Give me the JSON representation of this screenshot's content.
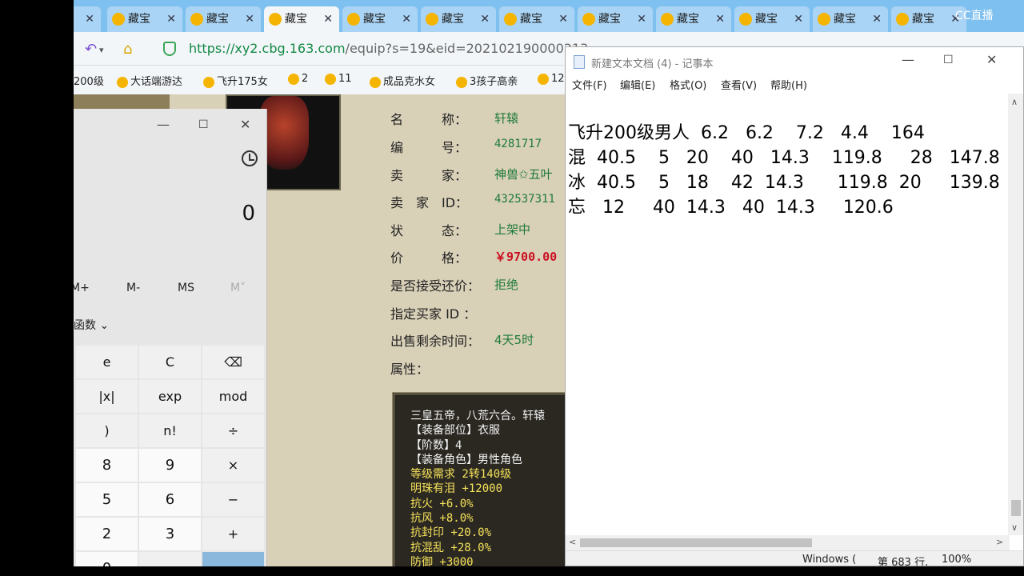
{
  "browser": {
    "tabs": [
      {
        "label": "",
        "active": false
      },
      {
        "label": "藏宝",
        "active": false
      },
      {
        "label": "藏宝",
        "active": false
      },
      {
        "label": "藏宝",
        "active": true
      },
      {
        "label": "藏宝",
        "active": false
      },
      {
        "label": "藏宝",
        "active": false
      },
      {
        "label": "藏宝",
        "active": false
      },
      {
        "label": "藏宝",
        "active": false
      },
      {
        "label": "藏宝",
        "active": false
      },
      {
        "label": "藏宝",
        "active": false
      },
      {
        "label": "藏宝",
        "active": false
      },
      {
        "label": "藏宝",
        "active": false
      }
    ],
    "url_main": "https://xy2.cbg.163.com",
    "url_rest": "/equip?s=19&eid=202102190000213",
    "bookmarks": [
      "200级",
      "大话端游达",
      "飞升175女",
      "2",
      "11",
      "成品克水女",
      "3孩子高亲",
      "12"
    ],
    "overlay_logo": "CC直播"
  },
  "item": {
    "fields": [
      {
        "label": "名　　　称：",
        "value": "轩辕"
      },
      {
        "label": "编　　　号：",
        "value": "4281717"
      },
      {
        "label": "卖　　　家：",
        "value": "神兽✩五叶"
      },
      {
        "label": "卖　家　ID：",
        "value": "432537311"
      },
      {
        "label": "状　　　态：",
        "value": "上架中"
      },
      {
        "label": "价　　　格：",
        "value": "￥9700.00"
      },
      {
        "label": "是否接受还价：",
        "value": "拒绝"
      },
      {
        "label": "指定买家 ID ：",
        "value": ""
      },
      {
        "label": "出售剩余时间：",
        "value": "4天5时"
      },
      {
        "label": "属性：",
        "value": ""
      }
    ],
    "attributes": [
      {
        "text": "三皇五帝，八荒六合。轩辕",
        "color": "white"
      },
      {
        "text": "【装备部位】衣服",
        "color": "white"
      },
      {
        "text": "【阶数】4",
        "color": "white"
      },
      {
        "text": "【装备角色】男性角色",
        "color": "white"
      },
      {
        "text": "等级需求 2转140级",
        "color": "yellow"
      },
      {
        "text": "明珠有泪 +12000",
        "color": "yellow"
      },
      {
        "text": "抗火 +6.0%",
        "color": "yellow"
      },
      {
        "text": "抗风 +8.0%",
        "color": "yellow"
      },
      {
        "text": "抗封印 +20.0%",
        "color": "yellow"
      },
      {
        "text": "抗混乱 +28.0%",
        "color": "yellow"
      },
      {
        "text": "防御 +3000",
        "color": "yellow"
      }
    ]
  },
  "calculator": {
    "display": "0",
    "memory": [
      "M+",
      "M-",
      "MS",
      "M˅"
    ],
    "function_menu": "函数",
    "keys": [
      [
        "e",
        "C",
        "⌫"
      ],
      [
        "|x|",
        "exp",
        "mod"
      ],
      [
        ")",
        "n!",
        "÷"
      ],
      [
        "8",
        "9",
        "×"
      ],
      [
        "5",
        "6",
        "−"
      ],
      [
        "2",
        "3",
        "+"
      ],
      [
        "0",
        "",
        "="
      ]
    ]
  },
  "notepad": {
    "title": "新建文本文档 (4) - 记事本",
    "menu": [
      "文件(F)",
      "编辑(E)",
      "格式(O)",
      "查看(V)",
      "帮助(H)"
    ],
    "lines": [
      "飞升200级男人  6.2   6.2    7.2   4.4    164",
      "混  40.5    5   20    40   14.3    119.8     28   147.8",
      "冰  40.5    5   18    42  14.3      119.8  20     139.8",
      "忘   12     40  14.3   40  14.3     120.6"
    ],
    "status": {
      "encoding": "Windows (",
      "position": "第 683 行,",
      "zoom": "100%"
    }
  }
}
